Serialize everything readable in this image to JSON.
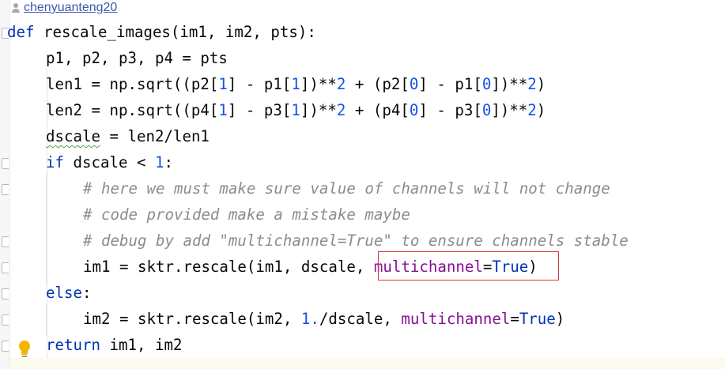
{
  "author": {
    "name": "chenyuanteng20",
    "icon": "user-icon"
  },
  "code": {
    "line_def": {
      "kw": "def",
      "rest": " rescale_images(im1, im2, pts):"
    },
    "line_unpack": "p1, p2, p3, p4 = pts",
    "line_len1": {
      "a": "len1 = np.sqrt((p2[",
      "n1": "1",
      "b": "] - p1[",
      "n2": "1",
      "c": "])**",
      "n3": "2",
      "d": " + (p2[",
      "n4": "0",
      "e": "] - p1[",
      "n5": "0",
      "f": "])**",
      "n6": "2",
      "g": ")"
    },
    "line_len2": {
      "a": "len2 = np.sqrt((p4[",
      "n1": "1",
      "b": "] - p3[",
      "n2": "1",
      "c": "])**",
      "n3": "2",
      "d": " + (p4[",
      "n4": "0",
      "e": "] - p3[",
      "n5": "0",
      "f": "])**",
      "n6": "2",
      "g": ")"
    },
    "line_dscale": {
      "var": "dscale",
      "rest": " = len2/len1"
    },
    "line_if": {
      "kw": "if",
      "a": " dscale < ",
      "num": "1",
      "b": ":"
    },
    "comment1": "# here we must make sure value of channels will not change",
    "comment2": "# code provided make a mistake maybe",
    "comment3": "# debug by add \"multichannel=True\" to ensure channels stable",
    "line_im1": {
      "a": "im1 = sktr.rescale(im1, dscale, ",
      "param": "multichannel",
      "eq": "=",
      "kw": "True",
      "b": ")"
    },
    "line_else": {
      "kw": "else",
      "b": ":"
    },
    "line_im2": {
      "a": "im2 = sktr.rescale(im2, ",
      "num": "1.",
      "b": "/dscale, ",
      "param": "multichannel",
      "eq": "=",
      "kw": "True",
      "c": ")"
    },
    "line_return": {
      "kw": "return",
      "rest": " im1, im2"
    }
  },
  "colors": {
    "keyword": "#0033b3",
    "number": "#1750eb",
    "parameter": "#871094",
    "comment": "#8c8c8c",
    "highlight": "#d53a3a"
  },
  "icons": {
    "intention": "lightbulb-icon"
  }
}
